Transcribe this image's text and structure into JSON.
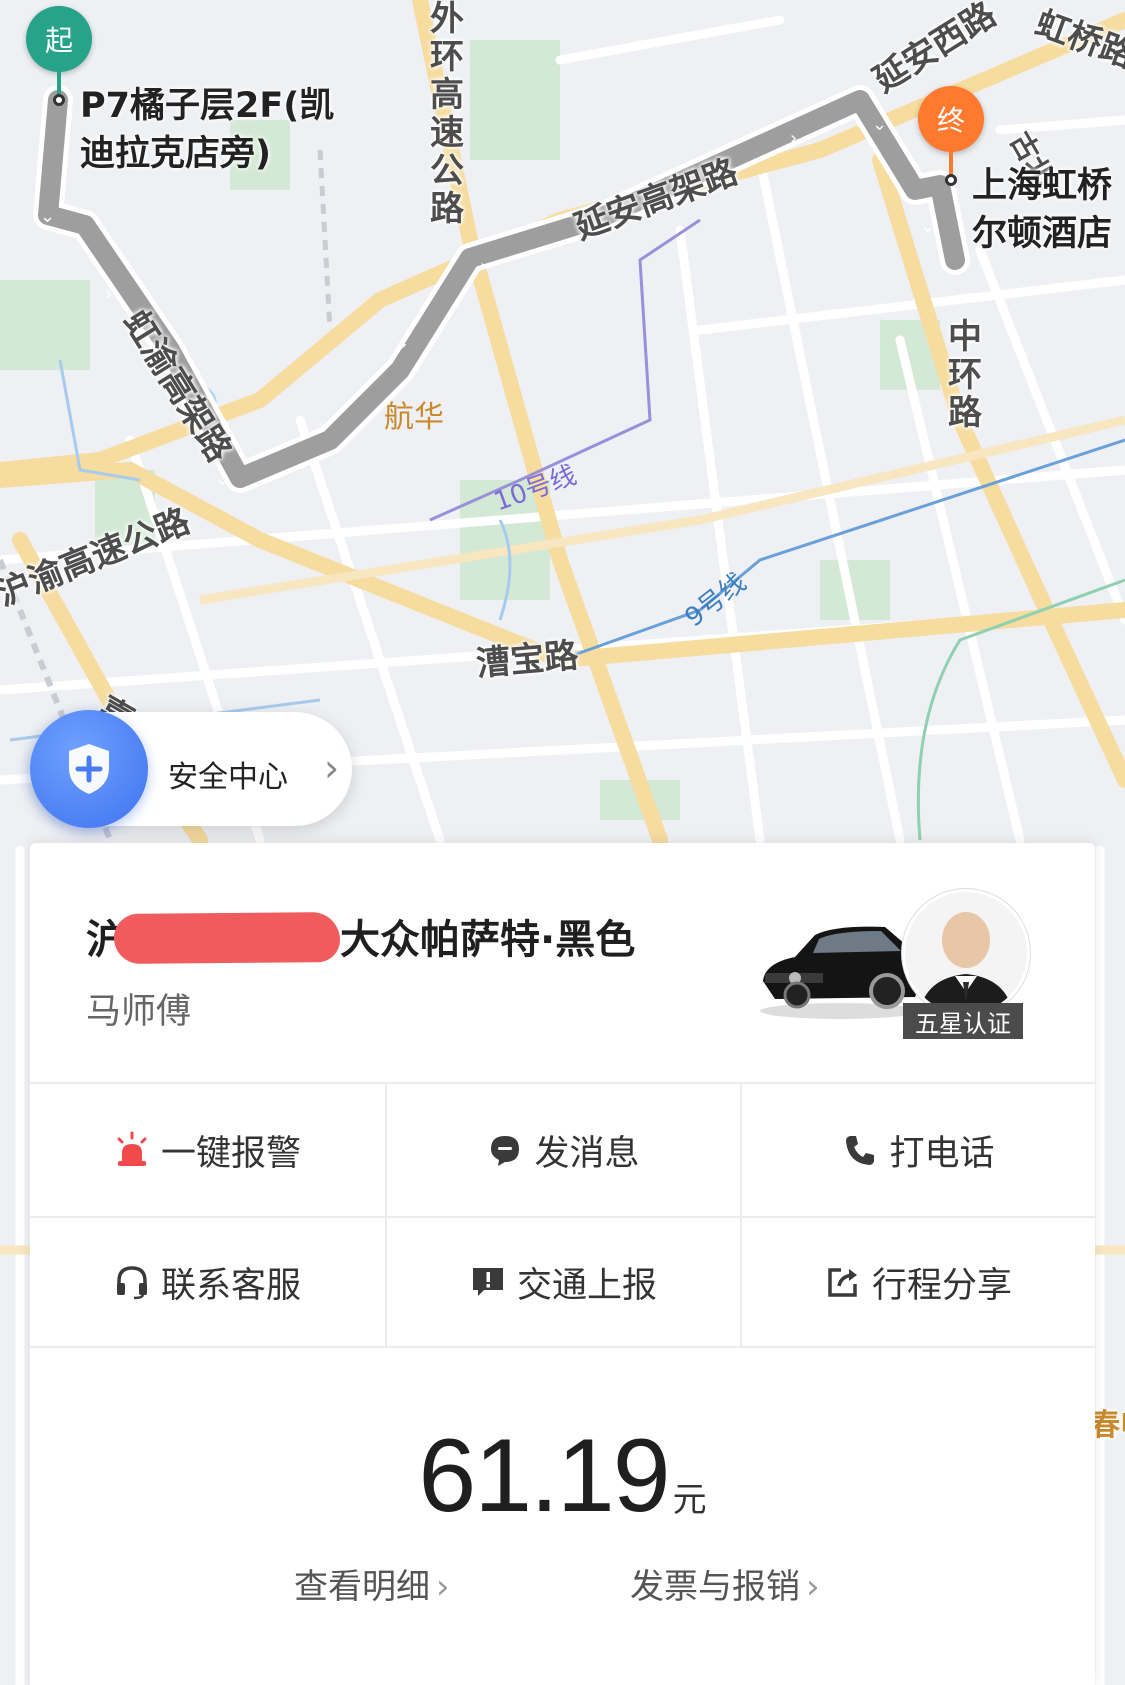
{
  "map": {
    "start_pin_label": "起",
    "end_pin_label": "终",
    "start_name_line1": "P7橘子层2F(凯",
    "start_name_line2": "迪拉克店旁)",
    "end_name_line1": "上海虹桥",
    "end_name_line2": "尔顿酒店",
    "roads": {
      "waihuan": "外环高速公路",
      "yanan_xi": "延安西路",
      "hongqiao": "虹桥路",
      "yanan_elevated": "延安高架路",
      "gubei": "古北",
      "zhonghuan": "中环路",
      "hongyu_elevated": "虹渝高架路",
      "huyu": "沪渝高速公路",
      "caobao": "漕宝路",
      "jia": "嘉",
      "shen": "春申"
    },
    "areas": {
      "hanghua": "航华"
    },
    "metro": {
      "line10": "10号线",
      "line9": "9号线"
    },
    "colors": {
      "start_pin": "#27a389",
      "end_pin": "#ff7a2e",
      "route": "#9e9e9e"
    }
  },
  "safety": {
    "label": "安全中心",
    "icon": "shield-plus-icon"
  },
  "trip_card": {
    "vehicle_desc": "沪A·····：大众帕萨特·黑色",
    "vehicle_visible": "大众帕萨特·黑色",
    "plate_first_char": "沪",
    "driver_name": "马师傅",
    "badge": "五星认证",
    "actions": [
      {
        "label": "一键报警",
        "icon": "alarm-siren-icon"
      },
      {
        "label": "发消息",
        "icon": "message-bubble-icon"
      },
      {
        "label": "打电话",
        "icon": "phone-icon"
      },
      {
        "label": "联系客服",
        "icon": "headset-icon"
      },
      {
        "label": "交通上报",
        "icon": "report-flag-icon"
      },
      {
        "label": "行程分享",
        "icon": "share-icon"
      }
    ],
    "fare": {
      "amount": "61.19",
      "unit": "元"
    },
    "links": {
      "detail": "查看明细",
      "invoice": "发票与报销"
    }
  }
}
